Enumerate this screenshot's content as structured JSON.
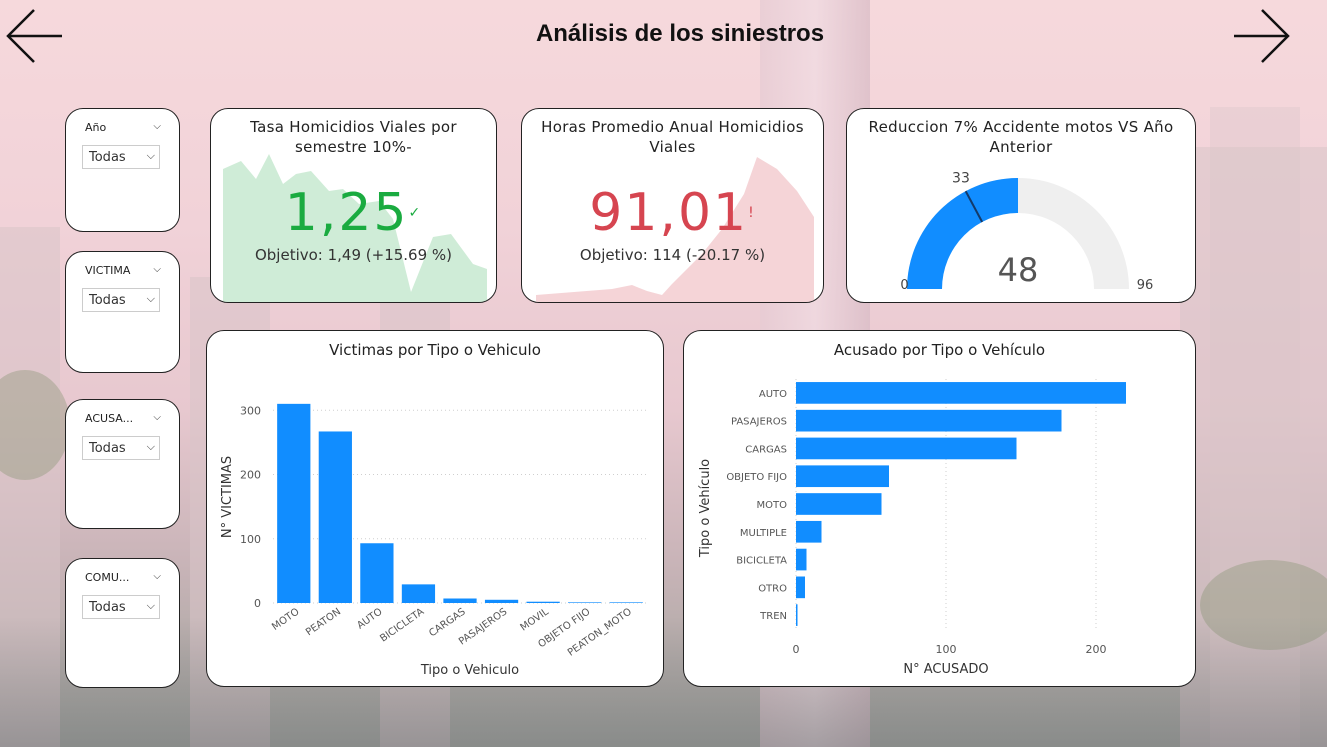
{
  "title": "Análisis de los siniestros",
  "nav": {
    "back_icon": "arrow-left-icon",
    "forward_icon": "arrow-right-icon"
  },
  "slicers": [
    {
      "label": "Año",
      "value": "Todas"
    },
    {
      "label": "VICTIMA",
      "value": "Todas"
    },
    {
      "label": "ACUSA...",
      "value": "Todas"
    },
    {
      "label": "COMU...",
      "value": "Todas"
    }
  ],
  "kpis": [
    {
      "title_line1": "Tasa Homicidios Viales por",
      "title_line2": "semestre 10%-",
      "value": "1,25",
      "status_icon": "✓",
      "target": "Objetivo: 1,49 (+15.69 %)",
      "color": "#1aab40"
    },
    {
      "title_line1": "Horas Promedio Anual Homicidios",
      "title_line2": "Viales",
      "value": "91,01",
      "status_icon": "!",
      "target": "Objetivo: 114 (-20.17 %)",
      "color": "#d64550"
    }
  ],
  "gauge": {
    "title_line1": "Reduccion 7% Accidente motos VS Año",
    "title_line2": "Anterior",
    "value": "48",
    "target": "33",
    "min": "0",
    "max": "96",
    "chart_data": {
      "type": "gauge",
      "value": 48,
      "target": 33,
      "min": 0,
      "max": 96
    }
  },
  "chart_victimas": {
    "title": "Victimas por Tipo o Vehiculo",
    "chart_data": {
      "type": "bar",
      "categories": [
        "MOTO",
        "PEATON",
        "AUTO",
        "BICICLETA",
        "CARGAS",
        "PASAJEROS",
        "MOVIL",
        "OBJETO FIJO",
        "PEATON_MOTO"
      ],
      "values": [
        310,
        267,
        93,
        29,
        7,
        5,
        2,
        1,
        1
      ],
      "xlabel": "Tipo o Vehiculo",
      "ylabel": "N° VICTIMAS",
      "ylim": [
        0,
        330
      ],
      "yticks": [
        "0",
        "100",
        "200",
        "300"
      ],
      "color": "#118dff"
    }
  },
  "chart_acusado": {
    "title": "Acusado por Tipo o Vehículo",
    "chart_data": {
      "type": "bar",
      "orientation": "horizontal",
      "categories": [
        "AUTO",
        "PASAJEROS",
        "CARGAS",
        "OBJETO FIJO",
        "MOTO",
        "MULTIPLE",
        "BICICLETA",
        "OTRO",
        "TREN"
      ],
      "values": [
        220,
        177,
        147,
        62,
        57,
        17,
        7,
        6,
        1
      ],
      "xlabel": "N° ACUSADO",
      "ylabel": "Tipo o Vehículo",
      "xlim": [
        0,
        240
      ],
      "xticks": [
        "0",
        "100",
        "200"
      ],
      "color": "#118dff"
    }
  }
}
